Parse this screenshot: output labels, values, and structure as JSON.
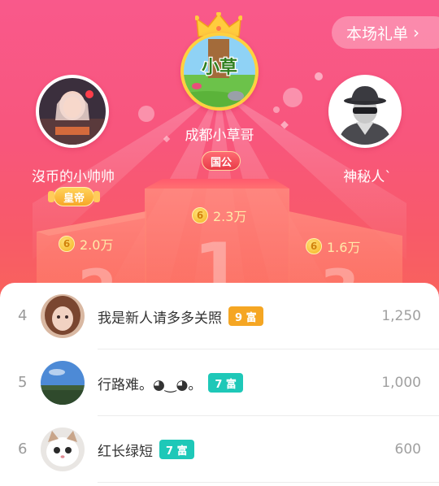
{
  "header": {
    "gift_list_label": "本场礼单",
    "gift_list_icon": "chevron-right-icon"
  },
  "podium": {
    "first": {
      "rank": 1,
      "name": "成都小草哥",
      "avatar_text": "小草",
      "tag": "国公",
      "amount": "2.3万",
      "crown_icon": "crown-icon"
    },
    "second": {
      "rank": 2,
      "name": "沒币的小帅帅",
      "tag": "皇帝",
      "amount": "2.0万"
    },
    "third": {
      "rank": 3,
      "name": "神秘人`",
      "amount": "1.6万",
      "avatar_icon": "mystery-user-icon"
    },
    "coin_glyph": "6"
  },
  "ranking": [
    {
      "rank": "4",
      "name": "我是新人请多多关照",
      "level": "9 富",
      "level_color": "#f5a623",
      "score": "1,250"
    },
    {
      "rank": "5",
      "name": "行路难。◕‿◕。",
      "level": "7 富",
      "level_color": "#1ec8b8",
      "score": "1,000"
    },
    {
      "rank": "6",
      "name": "红长绿短",
      "level": "7 富",
      "level_color": "#1ec8b8",
      "score": "600"
    }
  ],
  "colors": {
    "brand_pink": "#f8567c",
    "gold": "#ffcc3e",
    "text_dark": "#333333",
    "text_muted": "#a0a0a0"
  }
}
